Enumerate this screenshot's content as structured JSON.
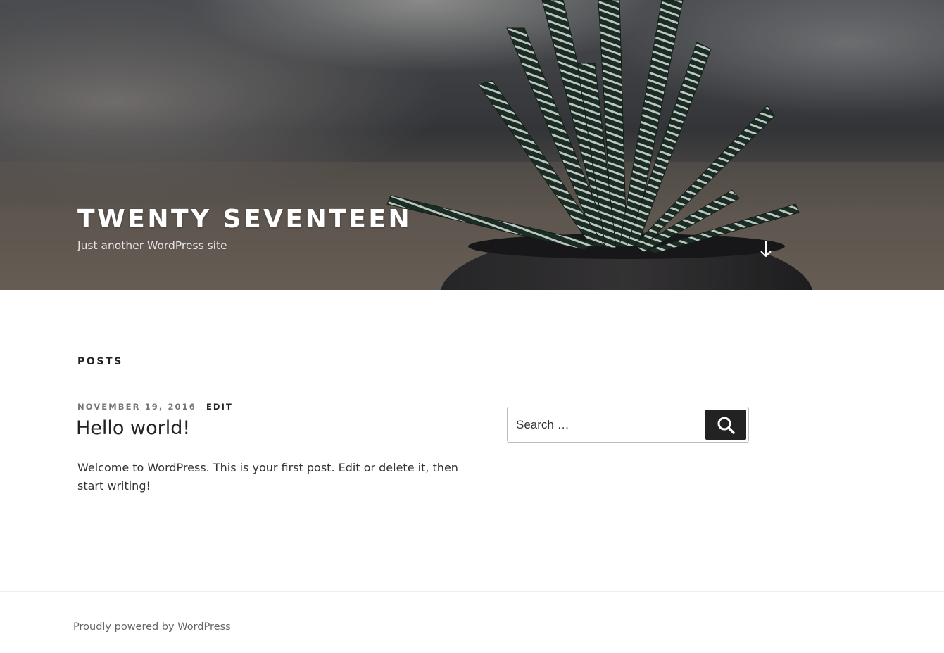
{
  "header": {
    "site_title": "Twenty Seventeen",
    "site_description": "Just another WordPress site",
    "header_image_alt": "succulent plant in dark pot",
    "scroll_icon": "arrow-down-icon"
  },
  "main": {
    "page_heading": "Posts",
    "post": {
      "date": "November 19, 2016",
      "edit_label": "Edit",
      "title": "Hello world!",
      "excerpt": "Welcome to WordPress. This is your first post. Edit or delete it, then start writing!"
    }
  },
  "sidebar": {
    "search": {
      "placeholder": "Search …",
      "submit_icon": "search-icon"
    }
  },
  "footer": {
    "credit": "Proudly powered by WordPress"
  },
  "colors": {
    "text_dark": "#222222",
    "text_meta": "#767676",
    "button_bg": "#222222",
    "header_overlay": "#3a3d42"
  }
}
